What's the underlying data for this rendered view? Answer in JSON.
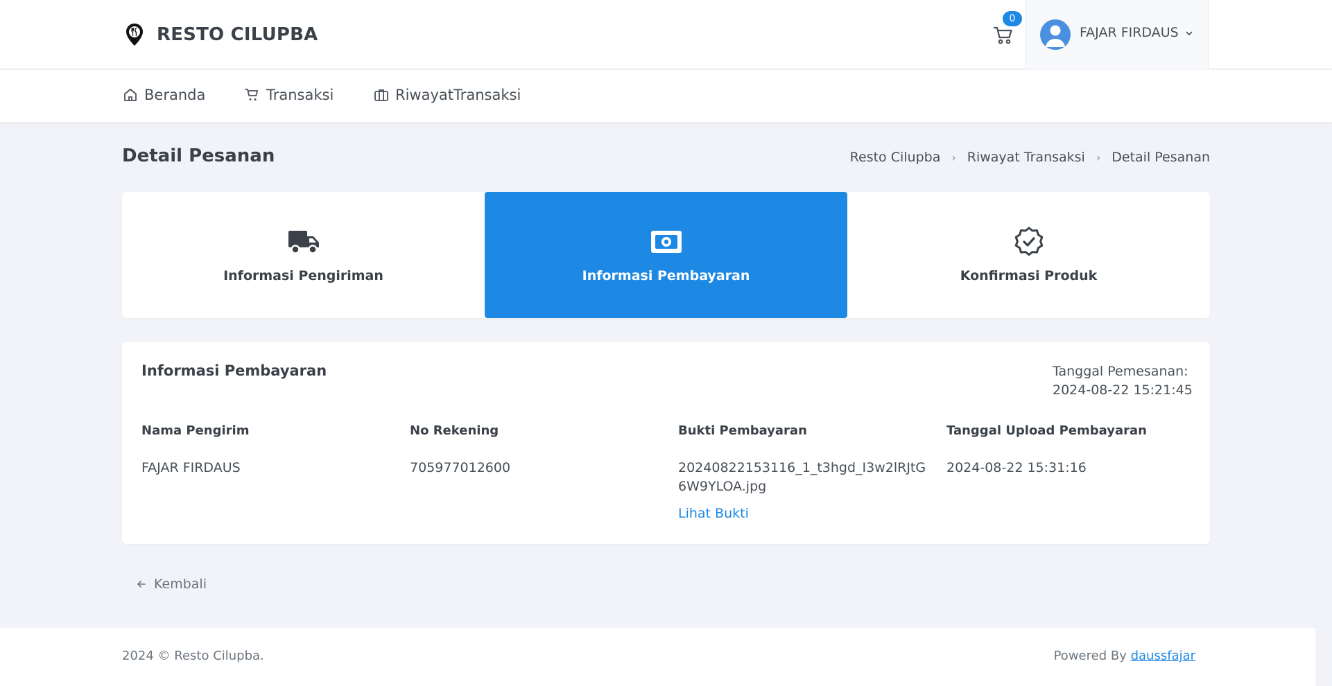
{
  "brand": {
    "name": "RESTO CILUPBA",
    "icon": "map-pin-fork-knife-icon"
  },
  "header": {
    "cart_count": "0",
    "user_name": "FAJAR FIRDAUS"
  },
  "nav": {
    "items": [
      {
        "label": "Beranda",
        "icon": "home-icon"
      },
      {
        "label": "Transaksi",
        "icon": "cart-icon"
      },
      {
        "label": "RiwayatTransaksi",
        "icon": "briefcase-icon"
      }
    ]
  },
  "page": {
    "title": "Detail Pesanan",
    "breadcrumb": [
      "Resto Cilupba",
      "Riwayat Transaksi",
      "Detail Pesanan"
    ],
    "breadcrumb_separator": "›"
  },
  "steps": [
    {
      "label": "Informasi Pengiriman",
      "icon": "truck-icon",
      "active": false
    },
    {
      "label": "Informasi Pembayaran",
      "icon": "money-icon",
      "active": true
    },
    {
      "label": "Konfirmasi Produk",
      "icon": "verified-badge-icon",
      "active": false
    }
  ],
  "payment": {
    "title": "Informasi Pembayaran",
    "order_date_label": "Tanggal Pemesanan:",
    "order_date": "2024-08-22 15:21:45",
    "columns": [
      {
        "header": "Nama Pengirim",
        "value": "FAJAR FIRDAUS"
      },
      {
        "header": "No Rekening",
        "value": "705977012600"
      },
      {
        "header": "Bukti Pembayaran",
        "value": "20240822153116_1_t3hgd_I3w2lRJtG6W9YLOA.jpg",
        "link": "Lihat Bukti"
      },
      {
        "header": "Tanggal Upload Pembayaran",
        "value": "2024-08-22 15:31:16"
      }
    ]
  },
  "back_label": "Kembali",
  "footer": {
    "copyright": "2024 © Resto Cilupba.",
    "powered_by": "Powered By",
    "author": "daussfajar"
  },
  "colors": {
    "accent": "#1e88e5",
    "background": "#f2f3f8",
    "text": "#495057"
  }
}
